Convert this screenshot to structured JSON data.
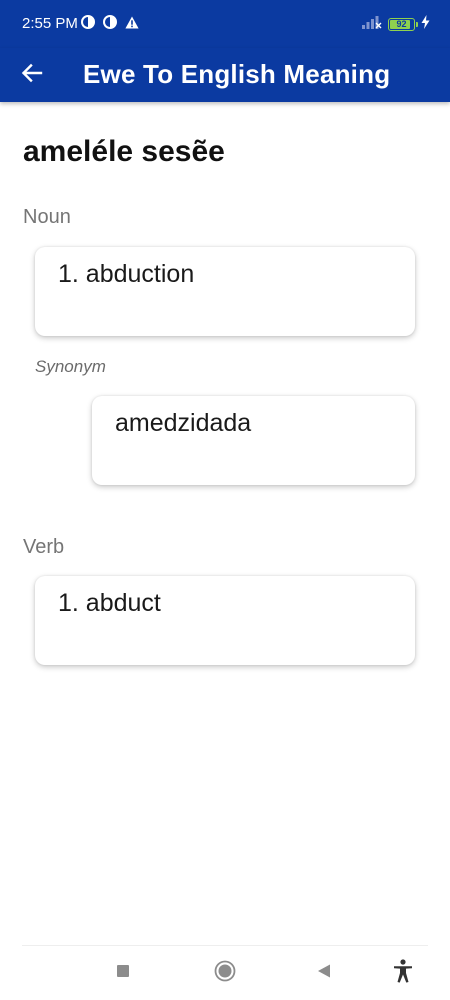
{
  "status_bar": {
    "time": "2:55 PM",
    "battery_level": "92",
    "battery_fraction": 0.92,
    "background_color": "#0b3aa1",
    "battery_color": "#8fd14f",
    "icons_left": [
      "data-saver-icon",
      "data-saver-icon",
      "warning-icon"
    ],
    "icons_right": [
      "signal-no-service-icon",
      "battery-icon",
      "charging-bolt-icon"
    ]
  },
  "app_bar": {
    "title": "Ewe To English Meaning",
    "back_icon": "arrow-back-icon",
    "background_color": "#0b3aa1"
  },
  "entry": {
    "headword": "ameléle sesẽe",
    "sections": [
      {
        "part_of_speech": "Noun",
        "meanings": [
          "1. abduction"
        ],
        "synonym_label": "Synonym",
        "synonyms": [
          "amedzidada"
        ]
      },
      {
        "part_of_speech": "Verb",
        "meanings": [
          "1. abduct"
        ]
      }
    ]
  },
  "nav_bar": {
    "icons": [
      "recents-square-icon",
      "home-circle-icon",
      "back-triangle-icon",
      "accessibility-icon"
    ]
  }
}
